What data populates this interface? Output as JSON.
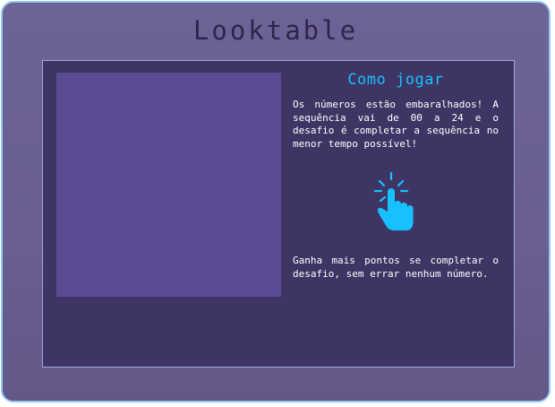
{
  "app": {
    "title": "Looktable"
  },
  "instructions": {
    "title": "Como jogar",
    "paragraph1": "Os números estão embaralhados! A sequência vai de 00 a 24 e o desafio é completar a sequência no menor tempo possível!",
    "paragraph2": "Ganha mais pontos se completar o desafio, sem errar nenhum número.",
    "icon": "tap-hand-icon"
  },
  "colors": {
    "frame_background": "#6d6397",
    "frame_border": "#93c9f0",
    "panel_background": "#3e3564",
    "board_background": "#5c4a92",
    "accent": "#17c1ff",
    "text": "#ffffff"
  }
}
